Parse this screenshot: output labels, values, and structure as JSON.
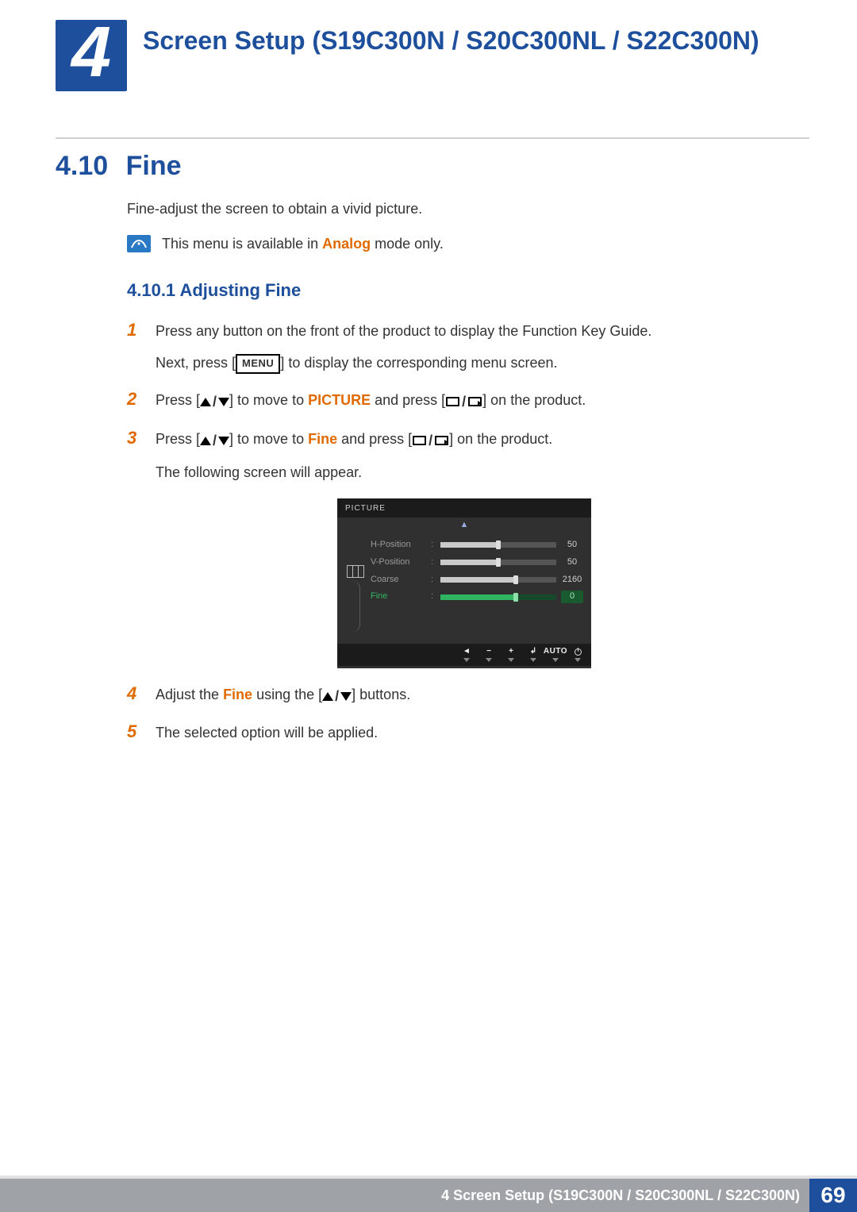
{
  "chapter": {
    "num": "4",
    "title": "Screen Setup (S19C300N / S20C300NL / S22C300N)"
  },
  "section": {
    "num": "4.10",
    "title": "Fine",
    "intro": "Fine-adjust the screen to obtain a vivid picture."
  },
  "note": {
    "pre": "This menu is available in ",
    "analog": "Analog",
    "post": " mode only."
  },
  "subsection": {
    "num": "4.10.1",
    "title": "Adjusting Fine",
    "label": "4.10.1  Adjusting Fine"
  },
  "navGlyphs": {
    "menuLabel": "MENU"
  },
  "steps": {
    "s1": {
      "n": "1",
      "p1": "Press any button on the front of the product to display the Function Key Guide.",
      "p2a": "Next, press [",
      "p2b": "] to display the corresponding menu screen."
    },
    "s2": {
      "n": "2",
      "a": "Press [",
      "b": "] to move to ",
      "picture": "PICTURE",
      "c": " and press [",
      "d": "] on the product."
    },
    "s3": {
      "n": "3",
      "a": "Press [",
      "b": "] to move to ",
      "fine": "Fine",
      "c": " and press [",
      "d": "] on the product.",
      "follow": "The following screen will appear."
    },
    "s4": {
      "n": "4",
      "a": "Adjust the ",
      "fine": "Fine",
      "b": " using the [",
      "c": "] buttons."
    },
    "s5": {
      "n": "5",
      "t": "The selected option will be applied."
    }
  },
  "osd": {
    "title": "PICTURE",
    "rows": [
      {
        "label": "H-Position",
        "value": "50",
        "pct": 50,
        "sel": false
      },
      {
        "label": "V-Position",
        "value": "50",
        "pct": 50,
        "sel": false
      },
      {
        "label": "Coarse",
        "value": "2160",
        "pct": 65,
        "sel": false
      },
      {
        "label": "Fine",
        "value": "0",
        "pct": 65,
        "sel": true
      }
    ],
    "bottomBar": {
      "back": "◄",
      "minus": "−",
      "plus": "+",
      "enter": "↲",
      "auto": "AUTO"
    }
  },
  "footer": {
    "title": "4 Screen Setup (S19C300N / S20C300NL / S22C300N)",
    "page": "69"
  }
}
